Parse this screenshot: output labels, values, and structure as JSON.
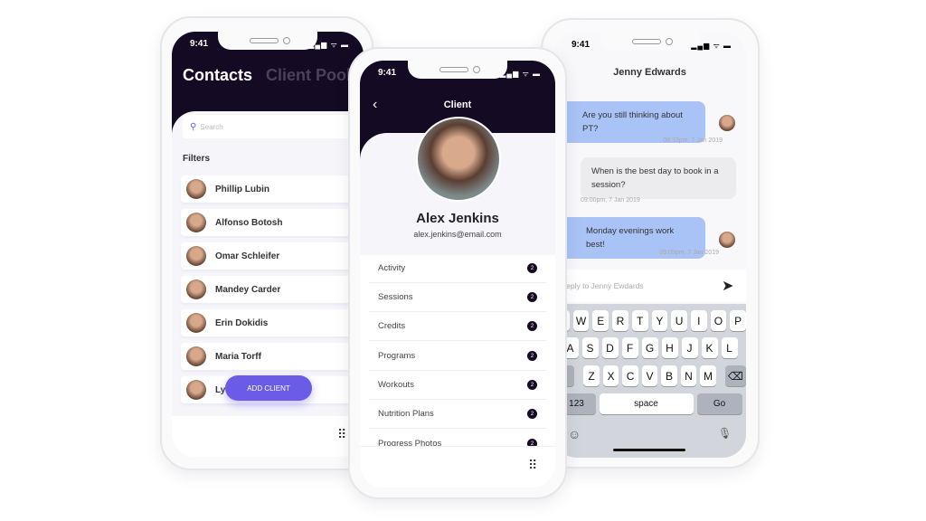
{
  "status": {
    "time": "9:41",
    "signal": "▂▄▆ ᯤ ▬"
  },
  "contacts": {
    "title": "Contacts",
    "tab2": "Client Pool",
    "search_placeholder": "Search",
    "filters": "Filters",
    "people": [
      "Phillip Lubin",
      "Alfonso Botosh",
      "Omar Schleifer",
      "Mandey Carder",
      "Erin Dokidis",
      "Maria Torff",
      "Ly"
    ],
    "add_client": "ADD CLIENT"
  },
  "client": {
    "title": "Client",
    "back": "‹",
    "name": "Alex Jenkins",
    "email": "alex.jenkins@email.com",
    "rows": [
      {
        "label": "Activity",
        "count": "2"
      },
      {
        "label": "Sessions",
        "count": "2"
      },
      {
        "label": "Credits",
        "count": "2"
      },
      {
        "label": "Programs",
        "count": "2"
      },
      {
        "label": "Workouts",
        "count": "2"
      },
      {
        "label": "Nutrition Plans",
        "count": "2"
      },
      {
        "label": "Progress Photos",
        "count": "2"
      }
    ]
  },
  "chat": {
    "title": "Jenny Edwards",
    "messages": [
      {
        "text": "Are you still thinking about PT?",
        "time": "08:33pm, 7 Jan 2019"
      },
      {
        "text": "When is the best day to book in a session?",
        "time": "09:00pm, 7 Jan 2019"
      },
      {
        "text": "Monday evenings work best!",
        "time": "09:05pm, 7 Jan 2019"
      }
    ],
    "reply_placeholder": "Reply to Jenny Ewdards",
    "keys": {
      "row1": [
        "Q",
        "W",
        "E",
        "R",
        "T",
        "Y",
        "U",
        "I",
        "O",
        "P"
      ],
      "row2": [
        "A",
        "S",
        "D",
        "F",
        "G",
        "H",
        "J",
        "K",
        "L"
      ],
      "row3": [
        "Z",
        "X",
        "C",
        "V",
        "B",
        "N",
        "M"
      ],
      "shift": "⇧",
      "del": "⌫",
      "num": "123",
      "space": "space",
      "go": "Go",
      "emoji": "☺",
      "mic": "🎙"
    }
  },
  "colors": {
    "dark": "#150a24",
    "accent": "#6b5ce7",
    "bubble_out": "#a9c3f7",
    "bubble_in": "#ececef"
  }
}
